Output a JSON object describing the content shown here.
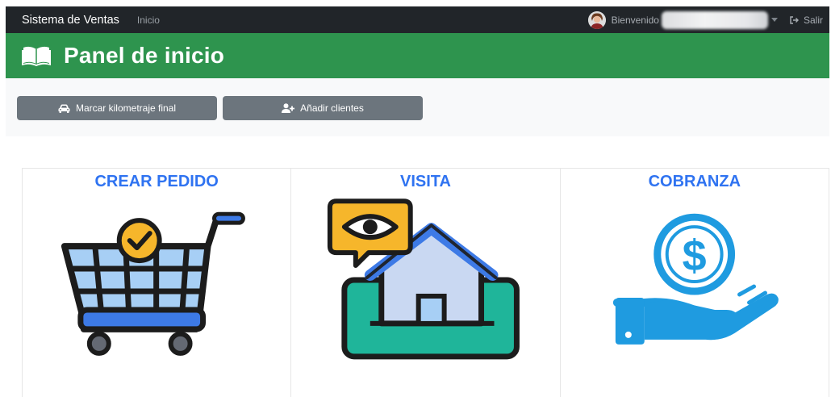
{
  "navbar": {
    "brand": "Sistema de Ventas",
    "home_link": "Inicio",
    "welcome": "Bienvenido",
    "logout": "Salir"
  },
  "header": {
    "title": "Panel de inicio"
  },
  "toolbar": {
    "km_button": "Marcar kilometraje final",
    "add_client_button": "Añadir clientes"
  },
  "cards": [
    {
      "title": "CREAR PEDIDO",
      "icon": "shopping-cart-check-icon"
    },
    {
      "title": "VISITA",
      "icon": "house-eye-icon"
    },
    {
      "title": "COBRANZA",
      "icon": "hand-dollar-coin-icon"
    }
  ],
  "colors": {
    "navbar": "#212529",
    "header": "#2e944e",
    "button": "#6c757d",
    "card_title": "#2f73f1"
  }
}
